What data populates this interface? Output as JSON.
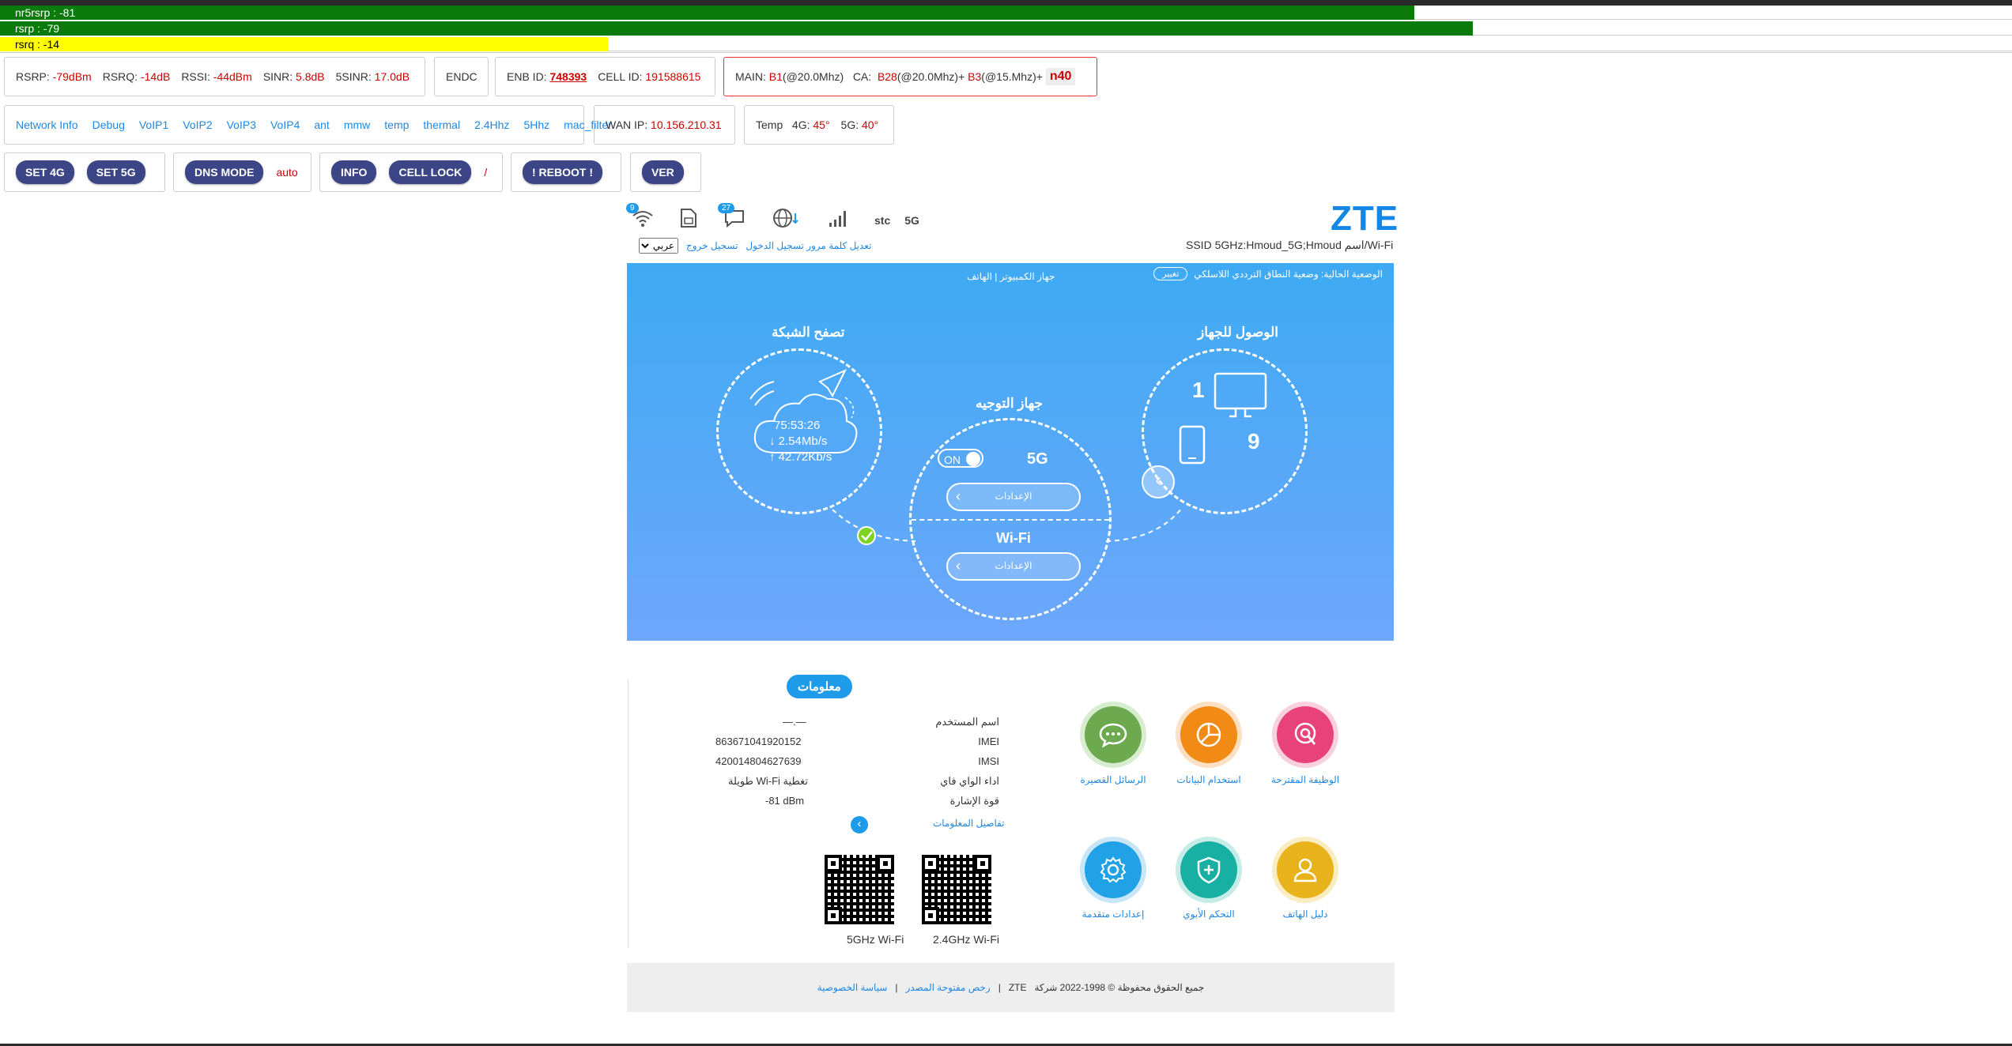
{
  "signal_bars": [
    {
      "label": "nr5rsrp : -81",
      "fill_fraction": 0.703,
      "color": "#0a7a0a"
    },
    {
      "label": "rsrp : -79",
      "fill_fraction": 0.732,
      "color": "#0a7a0a"
    },
    {
      "label": "rsrq : -14",
      "fill_fraction": 0.302,
      "color": "#ffff00"
    }
  ],
  "stats": {
    "rsrp_label": "RSRP:",
    "rsrp": "-79dBm",
    "rsrq_label": "RSRQ:",
    "rsrq": "-14dB",
    "rssi_label": "RSSI:",
    "rssi": "-44dBm",
    "sinr_label": "SINR:",
    "sinr": "5.8dB",
    "sinr5_label": "5SINR:",
    "sinr5": "17.0dB",
    "endc": "ENDC",
    "enb_label": "ENB ID:",
    "enb": "748393",
    "cell_label": "CELL ID:",
    "cell": "191588615",
    "main_label": "MAIN:",
    "main_band": "B1",
    "main_bw": "(@20.0Mhz)",
    "ca_label": "CA:",
    "ca1": "B28",
    "ca1_bw": "(@20.0Mhz)+",
    "ca2": "B3",
    "ca2_bw": "(@15.Mhz)+",
    "nr": "n40"
  },
  "links": [
    "Network Info",
    "Debug",
    "VoIP1",
    "VoIP2",
    "VoIP3",
    "VoIP4",
    "ant",
    "mmw",
    "temp",
    "thermal",
    "2.4Hhz",
    "5Hhz",
    "mac_filter"
  ],
  "wan": {
    "label": "WAN IP:",
    "value": "10.156.210.31"
  },
  "temp": {
    "label": "Temp",
    "l4g": "4G:",
    "v4g": "45°",
    "l5g": "5G:",
    "v5g": "40°"
  },
  "buttons": {
    "set4g": "SET 4G",
    "set5g": "SET 5G",
    "dns": "DNS MODE",
    "dns_value": "auto",
    "info": "INFO",
    "cell_lock": "CELL LOCK",
    "cell_lock_value": "/",
    "reboot": "! REBOOT !",
    "ver": "VER"
  },
  "header": {
    "logo": "ZTE",
    "wifi_badge": "9",
    "msg_badge": "27",
    "operator": "stc",
    "network": "5G",
    "ssid": "Wi-Fi/اسم SSID 5GHz:Hmoud_5G;Hmoud",
    "logout": "تسجيل خروج",
    "change_pwd": "تعديل كلمة مرور تسجيل الدخول",
    "language": "عربي"
  },
  "hero": {
    "mode": "الوضعية الحالية: وضعية النطاق الترددي اللاسلكي",
    "change": "تغيير",
    "tabs": "جهاز الكمبيوتر | الهاتف",
    "access_title": "الوصول للجهاز",
    "pc_count": "1",
    "phone_count": "9",
    "router_title": "جهاز التوجيه",
    "toggle": "ON",
    "band": "5G",
    "settings1": "الإعدادات",
    "wifi_label": "Wi-Fi",
    "settings2": "الإعدادات",
    "browse_title": "تصفح الشبكة",
    "uptime": "75:53:26",
    "down": "↓ 2.54Mb/s",
    "up": "↑ 42.72Kb/s"
  },
  "info": {
    "title": "معلومات",
    "rows": [
      {
        "label": "اسم المستخدم",
        "value": "—.—"
      },
      {
        "label": "IMEI",
        "value": "863671041920152"
      },
      {
        "label": "IMSI",
        "value": "420014804627639"
      },
      {
        "label": "اداء الواي فاي",
        "value": "تغطية Wi-Fi طويلة"
      },
      {
        "label": "قوة الإشارة",
        "value": "-81 dBm"
      }
    ],
    "details": "تفاصيل المعلومات",
    "qr_5g": "5GHz Wi-Fi",
    "qr_24g": "2.4GHz Wi-Fi"
  },
  "apps": [
    {
      "label": "الرسائل القصيرة",
      "color": "#6daa4f",
      "icon": "message-icon"
    },
    {
      "label": "استخدام البيانات",
      "color": "#f28a16",
      "icon": "pie-chart-icon"
    },
    {
      "label": "الوظيفة المقترحة",
      "color": "#e8427a",
      "icon": "search-icon"
    },
    {
      "label": "إعدادات متقدمة",
      "color": "#21a2e6",
      "icon": "gear-icon"
    },
    {
      "label": "التحكم الأبوي",
      "color": "#18b0a2",
      "icon": "shield-icon"
    },
    {
      "label": "دليل الهاتف",
      "color": "#e8b31a",
      "icon": "user-icon"
    }
  ],
  "footer": {
    "copyright": "جميع الحقوق محفوظة © 1998-2022 شركة",
    "zte": "ZTE",
    "oss": "رخص مفتوحة المصدر",
    "privacy": "سياسة الخصوصية"
  }
}
